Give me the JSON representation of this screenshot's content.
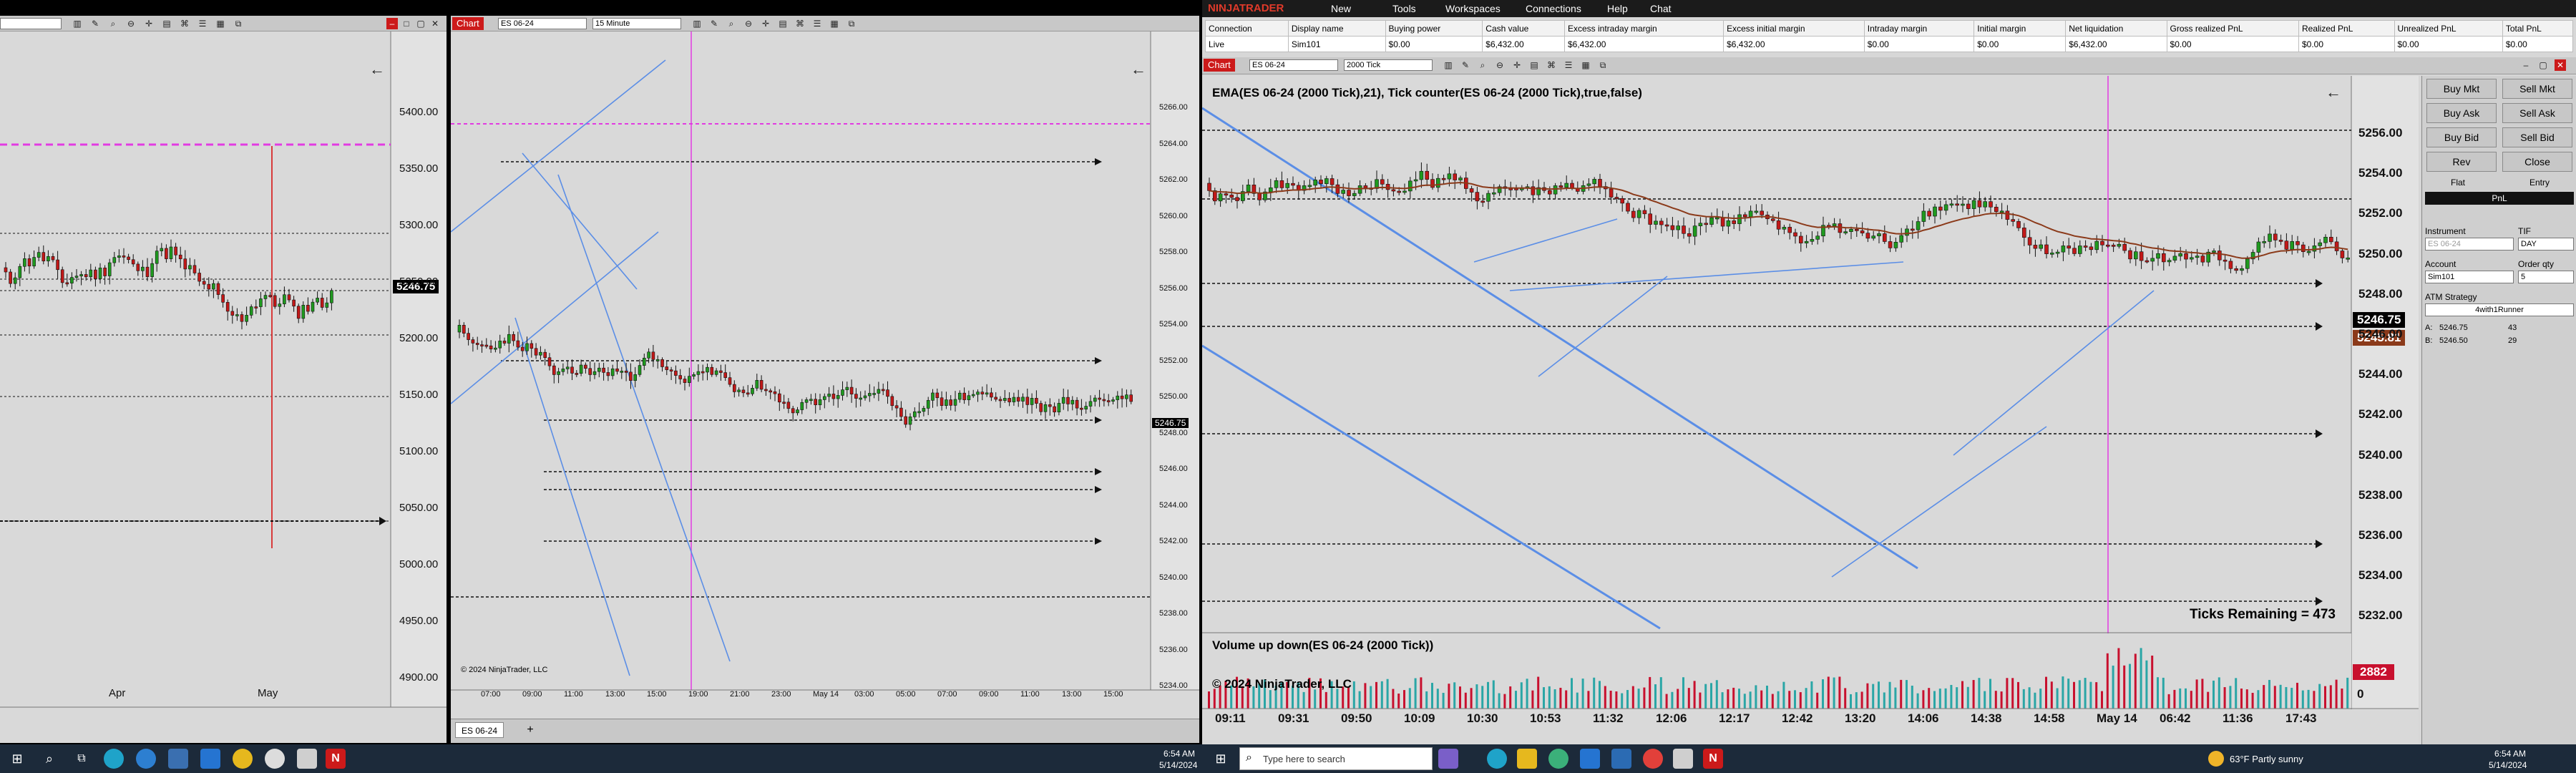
{
  "left_chart": {
    "y_ticks": [
      "5400.00",
      "5350.00",
      "5300.00",
      "5250.00",
      "5200.00",
      "5150.00",
      "5100.00",
      "5050.00",
      "5000.00",
      "4950.00",
      "4900.00"
    ],
    "last_price": "5246.75",
    "x_ticks": [
      "Apr",
      "May"
    ]
  },
  "mid_chart": {
    "tab": "Chart",
    "instrument": "ES 06-24",
    "interval": "15 Minute",
    "y_ticks": [
      "5266.00",
      "5264.00",
      "5262.00",
      "5260.00",
      "5258.00",
      "5256.00",
      "5254.00",
      "5252.00",
      "5250.00",
      "5248.00",
      "5246.00",
      "5244.00",
      "5242.00",
      "5240.00",
      "5238.00",
      "5236.00",
      "5234.00"
    ],
    "last_price": "5246.75",
    "x_ticks": [
      "07:00",
      "09:00",
      "11:00",
      "13:00",
      "15:00",
      "19:00",
      "21:00",
      "23:00",
      "May 14",
      "03:00",
      "05:00",
      "07:00",
      "09:00",
      "11:00",
      "13:00",
      "15:00"
    ],
    "copyright": "© 2024 NinjaTrader, LLC",
    "bottom_tab": "ES 06-24"
  },
  "ninja": {
    "logo": "NINJATRADER",
    "menu": [
      "New",
      "Tools",
      "Workspaces",
      "Connections",
      "Help",
      "Chat"
    ],
    "accounts_headers": [
      "Connection",
      "Display name",
      "Buying power",
      "Cash value",
      "Excess intraday margin",
      "Excess initial margin",
      "Intraday margin",
      "Initial margin",
      "Net liquidation",
      "Gross realized PnL",
      "Realized PnL",
      "Unrealized PnL",
      "Total PnL"
    ],
    "accounts_rows": [
      [
        "Live",
        "Sim101",
        "$0.00",
        "$6,432.00",
        "$6,432.00",
        "$6,432.00",
        "$0.00",
        "$0.00",
        "$6,432.00",
        "$0.00",
        "$0.00",
        "$0.00",
        "$0.00"
      ]
    ]
  },
  "right_chart": {
    "tab": "Chart",
    "instrument": "ES 06-24",
    "interval": "2000 Tick",
    "indicator_label": "EMA(ES 06-24 (2000 Tick),21), Tick counter(ES 06-24 (2000 Tick),true,false)",
    "y_ticks": [
      "5256.00",
      "5254.00",
      "5252.00",
      "5250.00",
      "5248.00",
      "5246.00",
      "5244.00",
      "5242.00",
      "5240.00",
      "5238.00",
      "5236.00",
      "5234.00",
      "5232.00"
    ],
    "last_price": "5246.75",
    "ema_price": "5245.81",
    "ticks_remaining": "Ticks Remaining = 473",
    "volume_label": "Volume up down(ES 06-24 (2000 Tick))",
    "volume_value": "2882",
    "volume_zero": "0",
    "copyright": "© 2024 NinjaTrader, LLC",
    "x_ticks": [
      "09:11",
      "09:31",
      "09:50",
      "10:09",
      "10:30",
      "10:53",
      "11:32",
      "12:06",
      "12:17",
      "12:42",
      "13:20",
      "14:06",
      "14:38",
      "14:58",
      "May 14",
      "06:42",
      "11:36",
      "17:43"
    ]
  },
  "chart_trader": {
    "buttons": [
      "Buy Mkt",
      "Sell Mkt",
      "Buy Ask",
      "Sell Ask",
      "Buy Bid",
      "Sell Bid",
      "Rev",
      "Close"
    ],
    "flat": "Flat",
    "entry": "Entry",
    "pnl": "PnL",
    "instrument_label": "Instrument",
    "instrument_value": "ES 06-24",
    "tif_label": "TIF",
    "tif_value": "DAY",
    "account_label": "Account",
    "account_value": "Sim101",
    "qty_label": "Order qty",
    "qty_value": "5",
    "atm_label": "ATM Strategy",
    "atm_value": "4with1Runner",
    "ask_label": "A:",
    "ask_price": "5246.75",
    "ask_size": "43",
    "bid_label": "B:",
    "bid_price": "5246.50",
    "bid_size": "29"
  },
  "taskbar_left": {
    "time": "6:54 AM",
    "date": "5/14/2024"
  },
  "taskbar_right": {
    "search_placeholder": "Type here to search",
    "weather": "63°F  Partly sunny",
    "time": "6:54 AM",
    "date": "5/14/2024"
  },
  "colors": {
    "bull": "#1f9a1f",
    "bear": "#c21818",
    "trend": "#5b8ee6",
    "magenta": "#e23be2",
    "accent_red": "#cc1a1a"
  }
}
